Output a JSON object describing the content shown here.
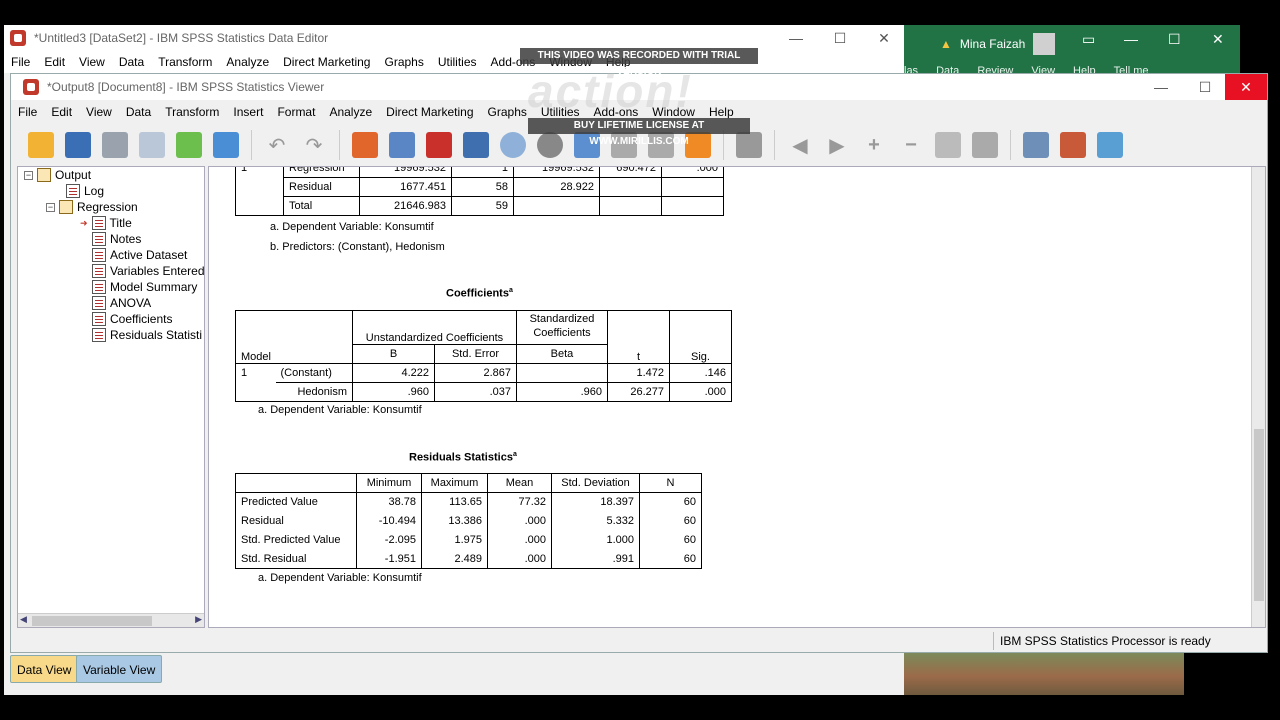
{
  "editor": {
    "title": "*Untitled3 [DataSet2] - IBM SPSS Statistics Data Editor",
    "menu": [
      "File",
      "Edit",
      "View",
      "Data",
      "Transform",
      "Analyze",
      "Direct Marketing",
      "Graphs",
      "Utilities",
      "Add-ons",
      "Window",
      "Help"
    ],
    "controls": [
      "—",
      "☐",
      "✕"
    ]
  },
  "excel": {
    "user": "Mina Faizah",
    "tabs": [
      "las",
      "Data",
      "Review",
      "View",
      "Help",
      "Tell me"
    ],
    "controls": [
      "▭",
      "—",
      "☐",
      "✕"
    ]
  },
  "viewer": {
    "title": "*Output8 [Document8] - IBM SPSS Statistics Viewer",
    "menu": [
      "File",
      "Edit",
      "View",
      "Data",
      "Transform",
      "Insert",
      "Format",
      "Analyze",
      "Direct Marketing",
      "Graphs",
      "Utilities",
      "Add-ons",
      "Window",
      "Help"
    ],
    "controls": [
      "—",
      "☐"
    ],
    "close": "✕"
  },
  "outline": {
    "root": "Output",
    "log": "Log",
    "regression": "Regression",
    "items": [
      "Title",
      "Notes",
      "Active Dataset",
      "Variables Entered",
      "Model Summary",
      "ANOVA",
      "Coefficients",
      "Residuals Statisti"
    ]
  },
  "anova": {
    "rows": [
      {
        "label": "Regression",
        "ss": "19969.532",
        "df": "1",
        "ms": "19969.532",
        "f": "690.472",
        "sig": ".000"
      },
      {
        "label": "Residual",
        "ss": "1677.451",
        "df": "58",
        "ms": "28.922",
        "f": "",
        "sig": ""
      },
      {
        "label": "Total",
        "ss": "21646.983",
        "df": "59",
        "ms": "",
        "f": "",
        "sig": ""
      }
    ],
    "model": "1",
    "footnote_a": "a. Dependent Variable: Konsumtif",
    "footnote_b": "b. Predictors: (Constant), Hedonism"
  },
  "coefficients": {
    "title": "Coefficients",
    "sup": "a",
    "h_unstd": "Unstandardized Coefficients",
    "h_std": "Standardized Coefficients",
    "h_model": "Model",
    "h_b": "B",
    "h_se": "Std. Error",
    "h_beta": "Beta",
    "h_t": "t",
    "h_sig": "Sig.",
    "model": "1",
    "rows": [
      {
        "label": "(Constant)",
        "b": "4.222",
        "se": "2.867",
        "beta": "",
        "t": "1.472",
        "sig": ".146"
      },
      {
        "label": "Hedonism",
        "b": ".960",
        "se": ".037",
        "beta": ".960",
        "t": "26.277",
        "sig": ".000"
      }
    ],
    "footnote": "a. Dependent Variable: Konsumtif"
  },
  "residuals": {
    "title": "Residuals Statistics",
    "sup": "a",
    "headers": [
      "Minimum",
      "Maximum",
      "Mean",
      "Std. Deviation",
      "N"
    ],
    "rows": [
      {
        "label": "Predicted Value",
        "v": [
          "38.78",
          "113.65",
          "77.32",
          "18.397",
          "60"
        ]
      },
      {
        "label": "Residual",
        "v": [
          "-10.494",
          "13.386",
          ".000",
          "5.332",
          "60"
        ]
      },
      {
        "label": "Std. Predicted Value",
        "v": [
          "-2.095",
          "1.975",
          ".000",
          "1.000",
          "60"
        ]
      },
      {
        "label": "Std. Residual",
        "v": [
          "-1.951",
          "2.489",
          ".000",
          ".991",
          "60"
        ]
      }
    ],
    "footnote": "a. Dependent Variable: Konsumtif"
  },
  "status": "IBM SPSS Statistics Processor is ready",
  "tabs": {
    "data_view": "Data View",
    "variable_view": "Variable View"
  },
  "watermark": {
    "top": "THIS VIDEO WAS RECORDED WITH TRIAL VERSION",
    "logo": "action!",
    "bottom": "BUY LIFETIME LICENSE AT WWW.MIRILLIS.COM"
  },
  "colors": {
    "close": "#e81123",
    "excel": "#217346",
    "data_tab": "#f8d98a",
    "variable_tab": "#a8c8e4"
  }
}
